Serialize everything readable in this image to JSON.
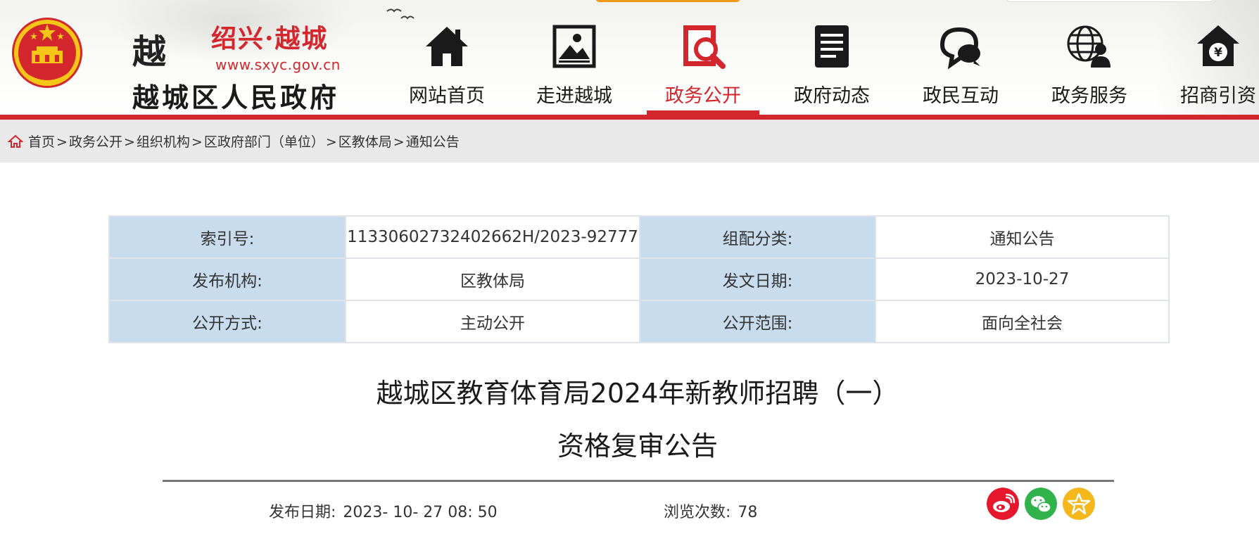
{
  "header": {
    "site": {
      "city": "绍兴·越城",
      "url": "www.sxyc.gov.cn",
      "government": "越城区人民政府",
      "glyph": "越"
    },
    "nav": [
      {
        "label": "网站首页",
        "icon": "home-icon",
        "active": false
      },
      {
        "label": "走进越城",
        "icon": "picture-icon",
        "active": false
      },
      {
        "label": "政务公开",
        "icon": "magnifier-document-icon",
        "active": true
      },
      {
        "label": "政府动态",
        "icon": "document-list-icon",
        "active": false
      },
      {
        "label": "政民互动",
        "icon": "chat-bubbles-icon",
        "active": false
      },
      {
        "label": "政务服务",
        "icon": "globe-person-icon",
        "active": false
      },
      {
        "label": "招商引资",
        "icon": "yuan-house-icon",
        "active": false
      }
    ],
    "accent_color": "#d3262d"
  },
  "breadcrumb": {
    "icon": "home-icon",
    "items": [
      "首页",
      "政务公开",
      "组织机构",
      "区政府部门（单位）",
      "区教体局",
      "通知公告"
    ],
    "separator": ">"
  },
  "meta": {
    "rows": [
      {
        "k1": "索引号:",
        "v1": "11330602732402662H/2023-92777",
        "k2": "组配分类:",
        "v2": "通知公告"
      },
      {
        "k1": "发布机构:",
        "v1": "区教体局",
        "k2": "发文日期:",
        "v2": "2023-10-27"
      },
      {
        "k1": "公开方式:",
        "v1": "主动公开",
        "k2": "公开范围:",
        "v2": "面向全社会"
      }
    ],
    "key_bg": "#c8dcee"
  },
  "article": {
    "title_line1": "越城区教育体育局2024年新教师招聘（一）",
    "title_line2": "资格复审公告"
  },
  "info": {
    "date_label": "发布日期:",
    "date_value": "2023- 10- 27 08: 50",
    "views_label": "浏览次数:",
    "views_value": "78"
  },
  "share": [
    {
      "icon": "weibo-icon",
      "color": "#e6162d"
    },
    {
      "icon": "wechat-icon",
      "color": "#2fb34a"
    },
    {
      "icon": "favorite-star-icon",
      "color": "#f5b81c"
    }
  ]
}
